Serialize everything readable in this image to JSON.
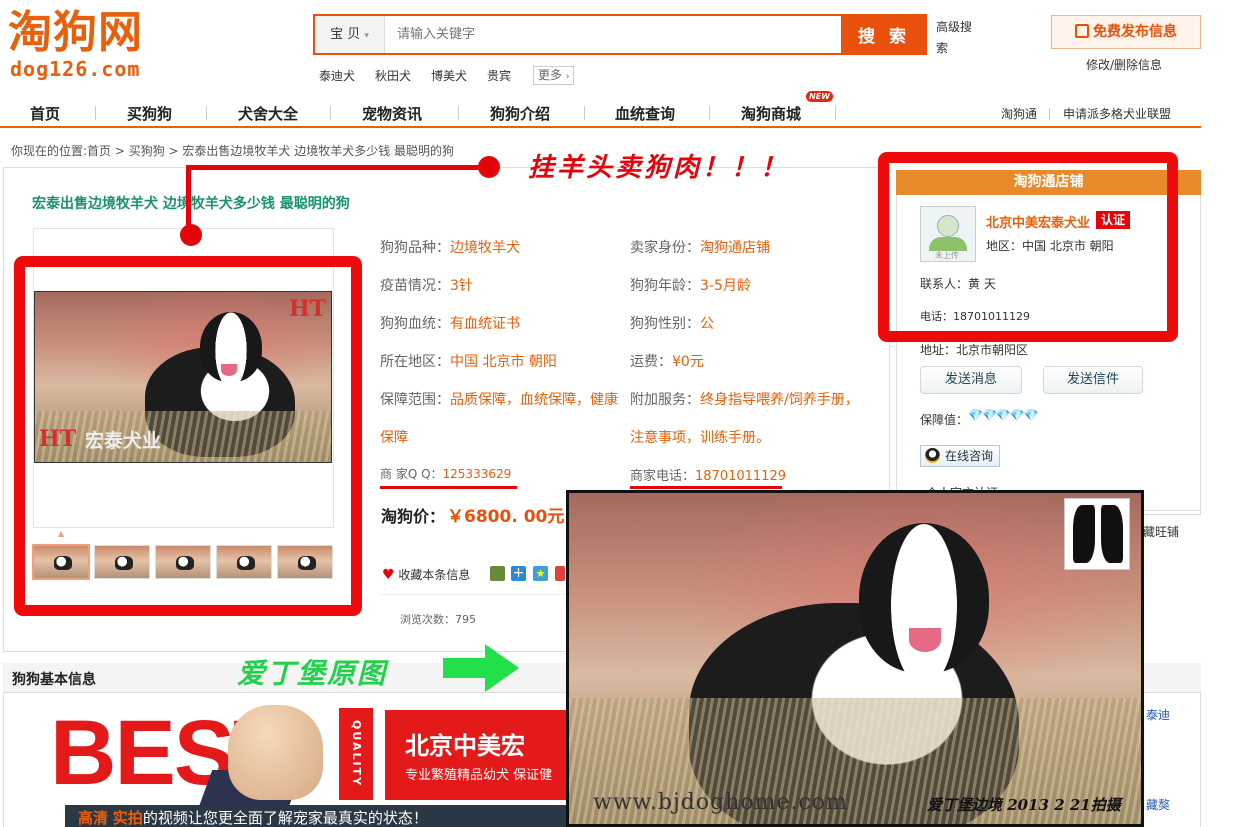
{
  "header": {
    "logo_cn": "淘狗网",
    "logo_en": "dog126.com",
    "search_category": "宝 贝",
    "search_placeholder": "请输入关键字",
    "search_button": "搜 索",
    "advanced_search": "高级搜索",
    "hot_keywords": [
      "泰迪犬",
      "秋田犬",
      "博美犬",
      "贵宾"
    ],
    "more": "更多",
    "publish_button": "免费发布信息",
    "modify_link": "修改/删除信息"
  },
  "nav": {
    "items": [
      "首页",
      "买狗狗",
      "犬舍大全",
      "宠物资讯",
      "狗狗介绍",
      "血统查询",
      "淘狗商城"
    ],
    "new_badge": "NEW",
    "right_links": [
      "淘狗通",
      "申请派多格犬业联盟"
    ]
  },
  "breadcrumb": "你现在的位置:首页 > 买狗狗 > 宏泰出售边境牧羊犬 边境牧羊犬多少钱 最聪明的狗",
  "annotations": {
    "top": "挂羊头卖狗肉！！！",
    "bottom": "爱丁堡原图"
  },
  "product": {
    "title": "宏泰出售边境牧羊犬  边境牧羊犬多少钱  最聪明的狗",
    "watermark_ht": "HT",
    "watermark_name": "宏泰犬业",
    "thumb_count": 5,
    "fields": [
      {
        "label": "狗狗品种：",
        "value": "边境牧羊犬"
      },
      {
        "label": "卖家身份：",
        "value": "淘狗通店铺"
      },
      {
        "label": "疫苗情况：",
        "value": "3针"
      },
      {
        "label": "狗狗年龄：",
        "value": "3-5月龄"
      },
      {
        "label": "狗狗血统：",
        "value": "有血统证书"
      },
      {
        "label": "狗狗性别：",
        "value": "公"
      },
      {
        "label": "所在地区：",
        "value": "中国 北京市 朝阳"
      },
      {
        "label": "运费：",
        "value": "¥0元"
      },
      {
        "label": "保障范围：",
        "value": "品质保障，血统保障，健康"
      },
      {
        "label": "附加服务：",
        "value": "终身指导喂养/饲养手册，"
      },
      {
        "label": "",
        "value": "保障"
      },
      {
        "label": "",
        "value": "注意事项，训练手册。"
      }
    ],
    "qq_label": "商 家Q Q：",
    "qq_value": "125333629",
    "phone_label": "商家电话：",
    "phone_value": "18701011129",
    "price_label": "淘狗价：",
    "price_value": "￥6800. 00元",
    "favorite": "收藏本条信息",
    "views": "浏览次数：795"
  },
  "shop": {
    "header": "淘狗通店铺",
    "avatar_caption": "未上传",
    "name": "北京中美宏泰犬业",
    "verified": "认证",
    "region": "地区：中国 北京市 朝阳",
    "contact": "联系人：黄 天",
    "phone": "电话：18701011129",
    "address": "地址：北京市朝阳区",
    "send_message": "发送消息",
    "send_letter": "发送信件",
    "guarantee_label": "保障值：",
    "diamonds": "💎💎💎💎💎",
    "online": "在线咨询",
    "partial1": "个人官方认证",
    "partial2": "藏旺铺"
  },
  "lower": {
    "section_title": "狗狗基本信息",
    "banner_best": "BEST",
    "banner_quality": "QUALITY",
    "banner_title": "北京中美宏",
    "banner_sub": "专业繁殖精品幼犬 保证健",
    "video_text_a": "高清",
    "video_text_b": "实拍",
    "video_text_c": "的视频让您更全面了解宠家最真实的状态！",
    "side_link1": "泰迪",
    "side_link2": "藏獒"
  },
  "big_photo": {
    "caption_left": "www.bjdoghome.com",
    "caption_right": "爱丁堡边境 2013 2 21拍摄"
  },
  "colors": {
    "brand": "#e8600c",
    "highlight_red": "#ee0a0a",
    "title_green": "#17936f",
    "annot_green": "#22d14a"
  }
}
